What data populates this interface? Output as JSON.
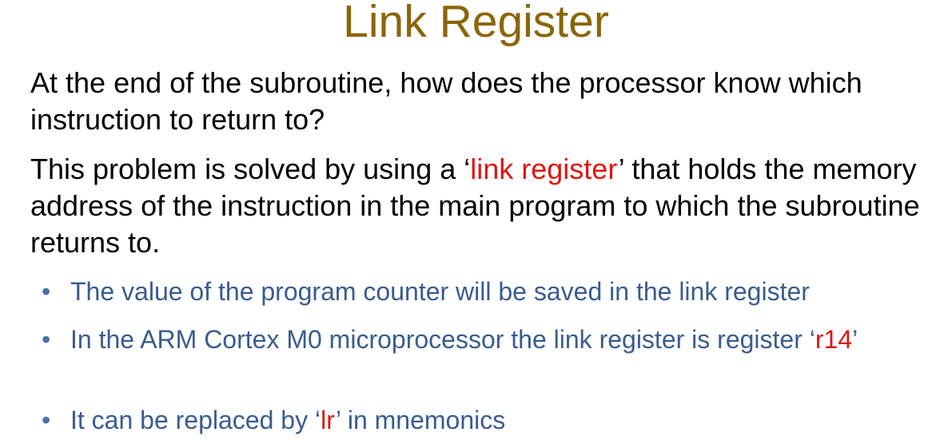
{
  "slide": {
    "title": "Link Register",
    "paragraphs": [
      {
        "text": "At the end of the subroutine, how does the processor know which instruction to return to?"
      },
      {
        "before": "This problem is solved by using a ‘",
        "highlight": "link register",
        "after": "’ that holds the memory address of the instruction in the main program to which the subroutine returns to."
      }
    ],
    "bullets": [
      {
        "marker": "•",
        "before": "The value of the program counter will be saved in the link register",
        "highlight": "",
        "after": ""
      },
      {
        "marker": "•",
        "before": "In the ARM Cortex M0 microprocessor the link register is register ‘",
        "highlight": "r14",
        "after": "’"
      },
      {
        "marker": "•",
        "before": "It can be replaced by ‘",
        "highlight": "lr",
        "after": "’ in mnemonics"
      }
    ]
  },
  "colors": {
    "title": "#8b6508",
    "body_text": "#000000",
    "highlight": "#e0150f",
    "bullet_text": "#3a5c8e"
  }
}
